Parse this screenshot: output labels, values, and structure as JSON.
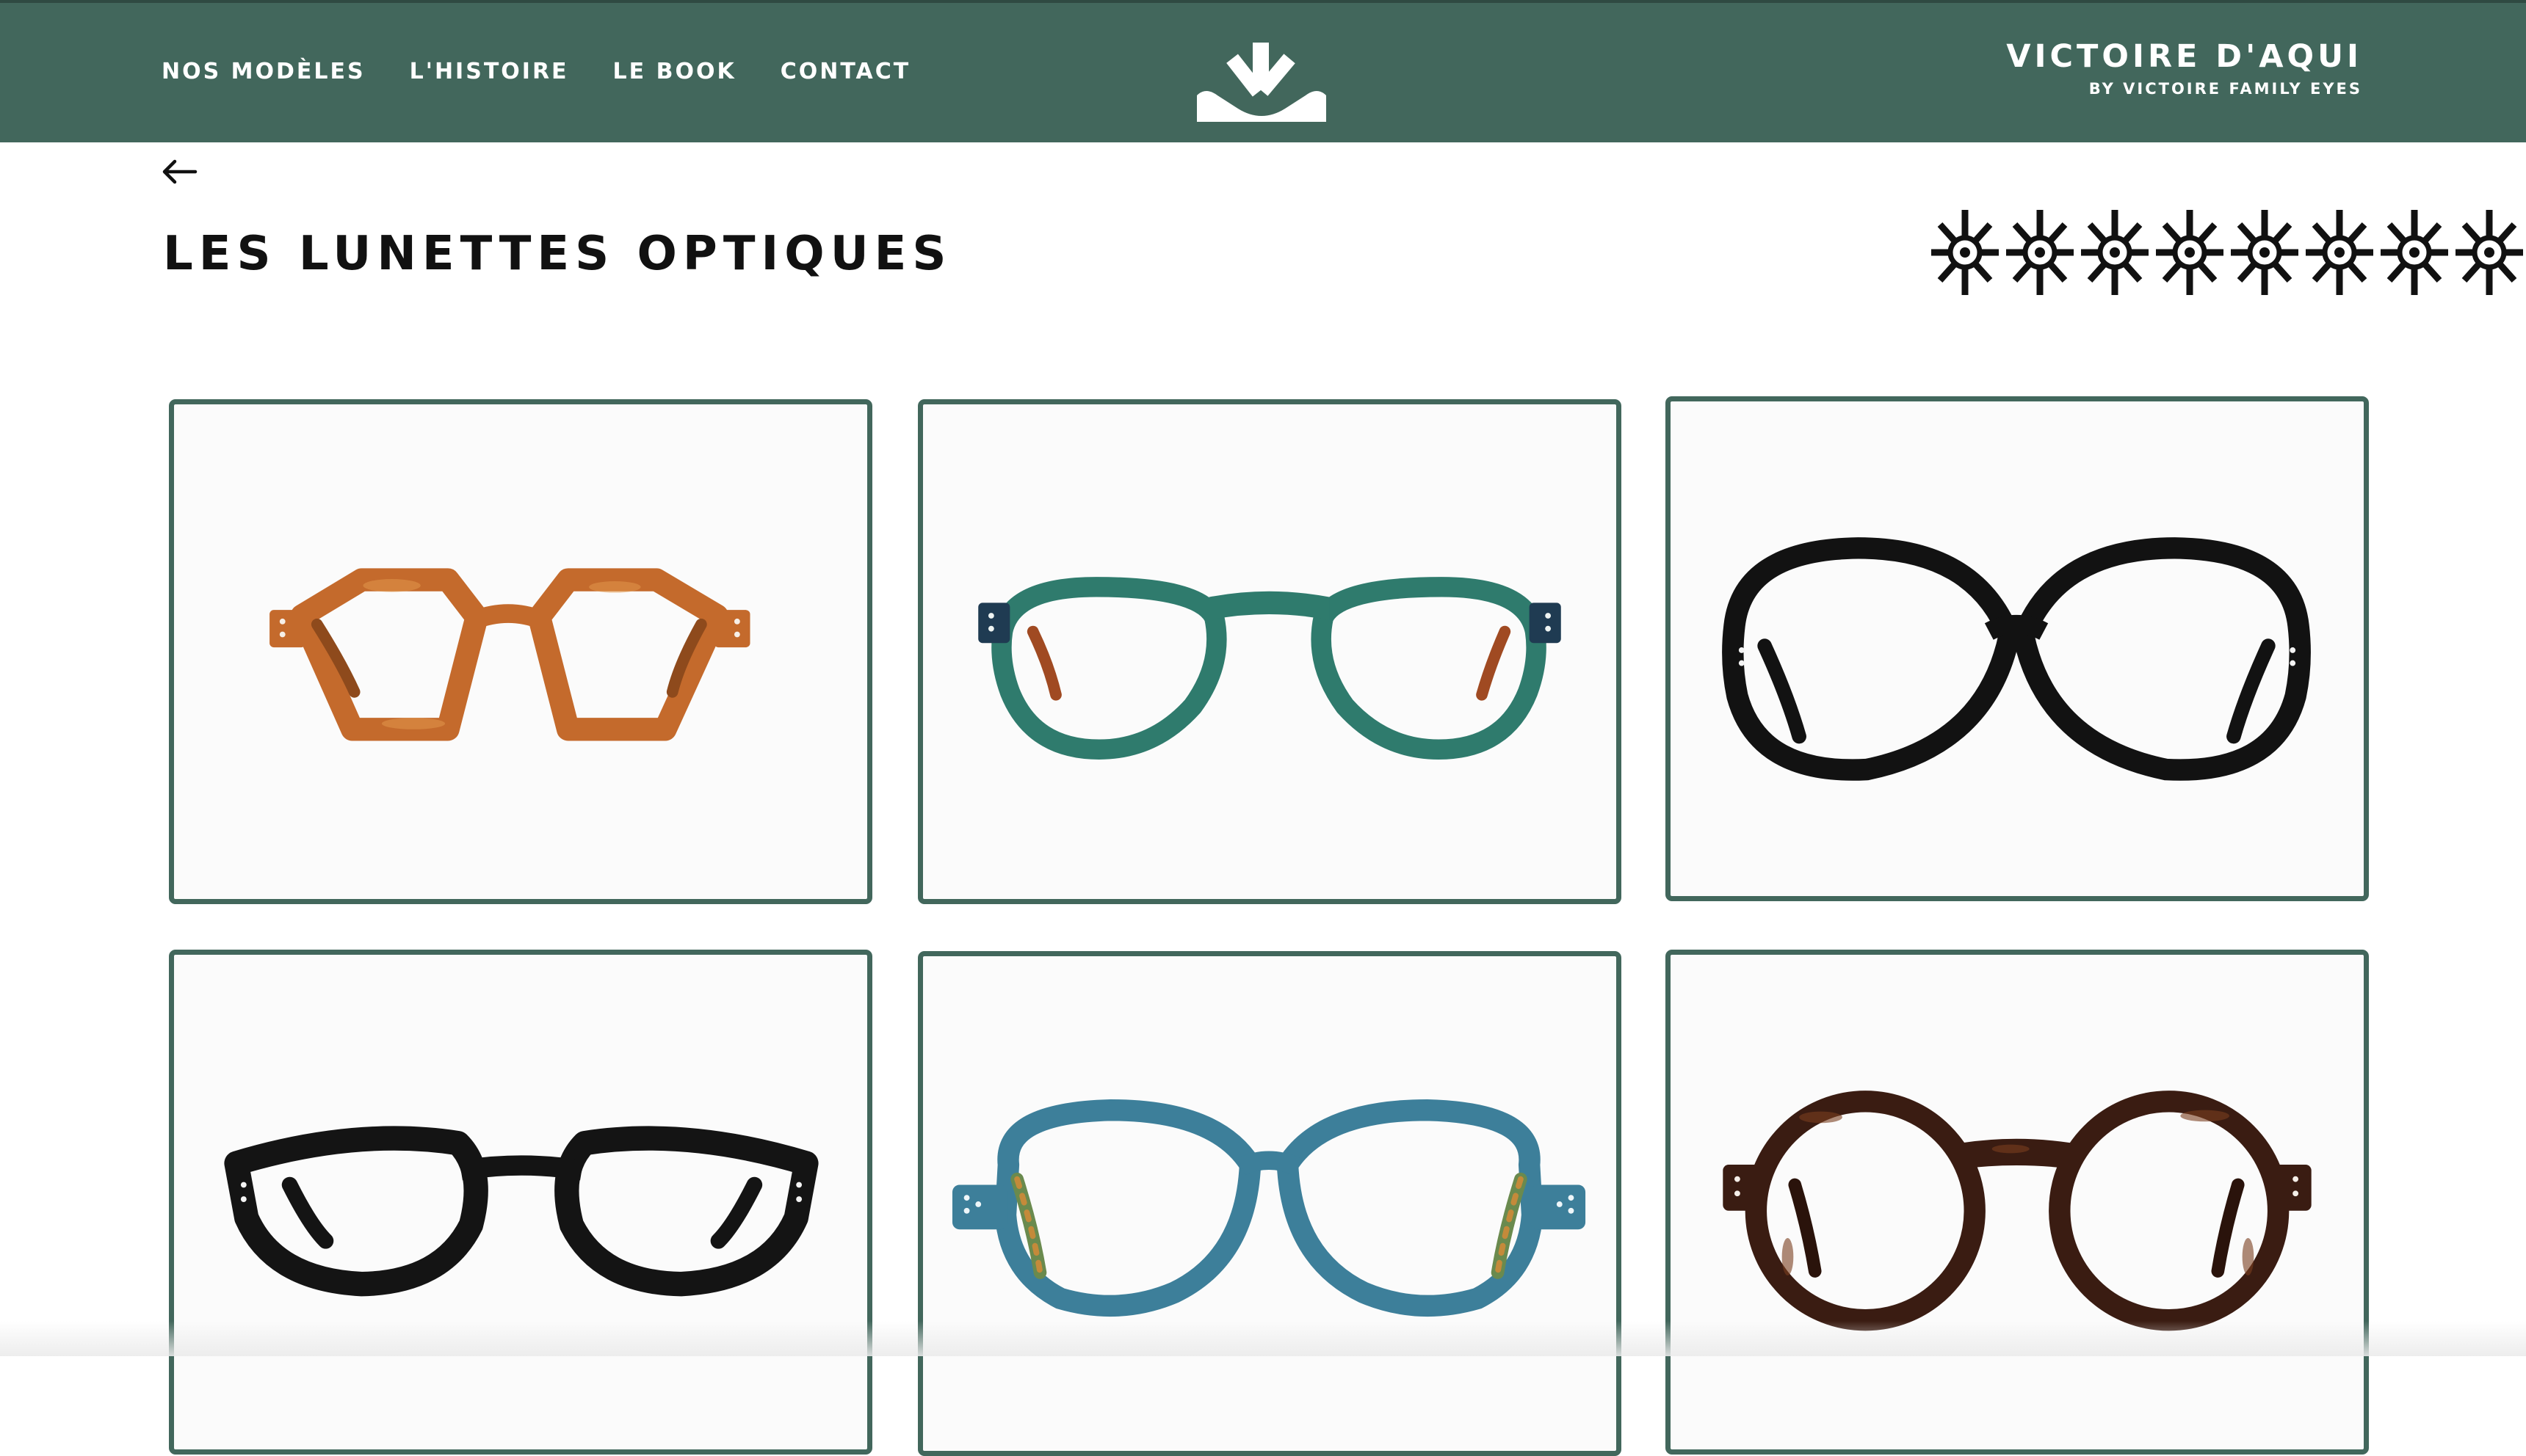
{
  "header": {
    "nav": [
      "NOS MODÈLES",
      "L'HISTOIRE",
      "LE BOOK",
      "CONTACT"
    ],
    "brand_name": "VICTOIRE D'AQUI",
    "brand_sub": "BY VICTOIRE FAMILY EYES",
    "logo_icon": "sun-rays-logo",
    "background": "#42675c"
  },
  "page": {
    "back_icon": "arrow-left-icon",
    "title": "LES LUNETTES OPTIQUES",
    "ornament_icon": "asterisk-star-pattern"
  },
  "products": [
    {
      "frame": "hexagonal",
      "color": "honey tortoise",
      "hex": "#c46a2c"
    },
    {
      "frame": "panto keyhole",
      "color": "teal green",
      "hex": "#2f7b6d"
    },
    {
      "frame": "round oversized",
      "color": "black",
      "hex": "#121212"
    },
    {
      "frame": "cat-eye",
      "color": "black",
      "hex": "#141414"
    },
    {
      "frame": "round butterfly",
      "color": "blue",
      "hex": "#3d7f9a"
    },
    {
      "frame": "round keyhole",
      "color": "dark tortoise",
      "hex": "#3a1c12"
    }
  ],
  "colors": {
    "accent": "#42675c",
    "text": "#111111",
    "card_border": "#42675c"
  }
}
